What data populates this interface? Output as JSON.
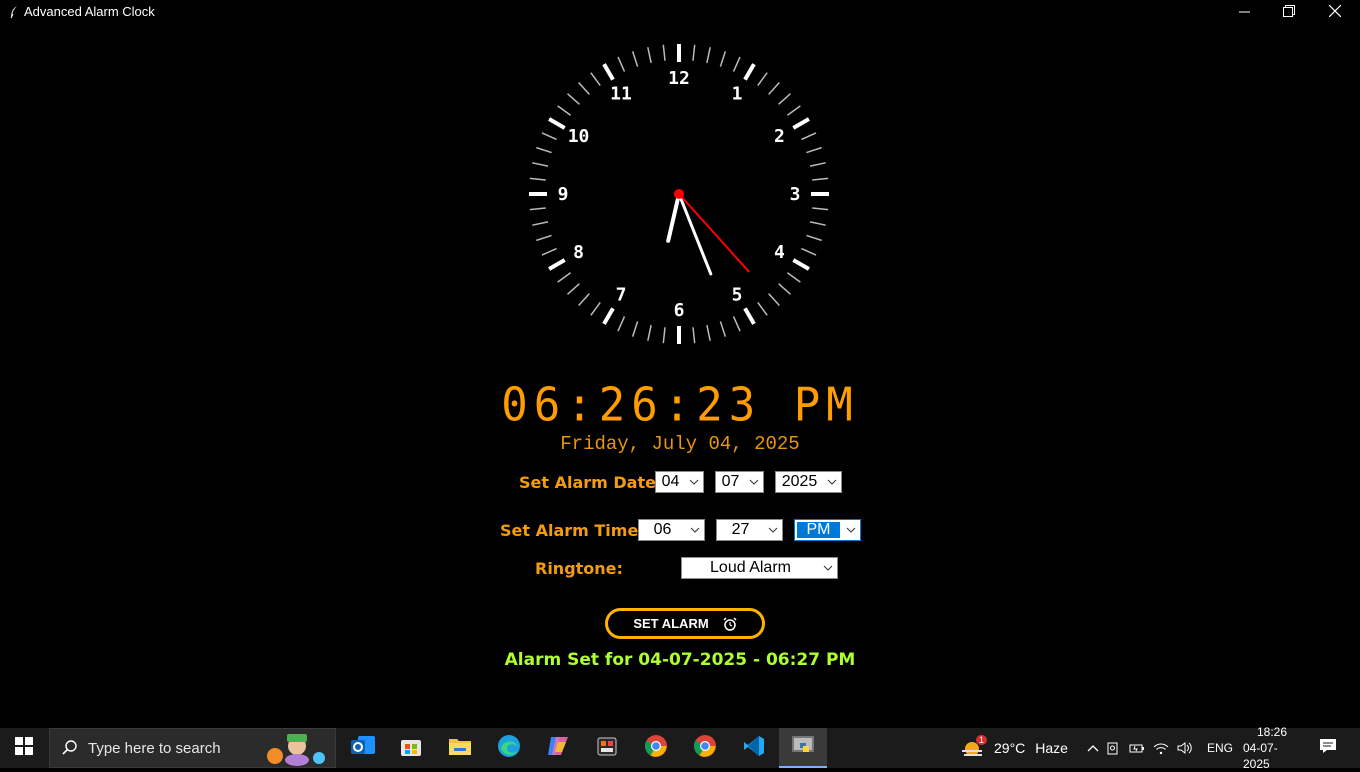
{
  "window": {
    "title": "Advanced Alarm Clock",
    "minimize_icon": "minimize-icon",
    "maximize_icon": "restore-icon",
    "close_icon": "close-icon"
  },
  "analog_clock": {
    "numerals": [
      "12",
      "1",
      "2",
      "3",
      "4",
      "5",
      "6",
      "7",
      "8",
      "9",
      "10",
      "11"
    ],
    "time": {
      "hour": 6,
      "minute": 26,
      "second": 23
    },
    "colors": {
      "face": "#000000",
      "ticks": "#ffffff",
      "second_hand": "#ff0000",
      "center": "#ff0000"
    }
  },
  "digital_time": "06:26:23 PM",
  "date_text": "Friday, July 04, 2025",
  "alarm_form": {
    "date_label": "Set Alarm Date:",
    "date_day": "04",
    "date_month": "07",
    "date_year": "2025",
    "time_label": "Set Alarm Time:",
    "time_hour": "06",
    "time_minute": "27",
    "time_ampm": "PM",
    "ringtone_label": "Ringtone:",
    "ringtone": "Loud Alarm"
  },
  "set_alarm_button": {
    "label": "SET ALARM",
    "icon": "alarm-clock-icon"
  },
  "status_text": "Alarm Set for 04-07-2025 - 06:27 PM",
  "colors": {
    "accent": "#f39c12",
    "digital": "#ff9d00",
    "status": "#adff2f",
    "button_border": "#ffb300"
  },
  "taskbar": {
    "search_placeholder": "Type here to search",
    "apps": [
      "outlook-icon",
      "microsoft-store-icon",
      "file-explorer-icon",
      "edge-icon",
      "copilot-icon",
      "app-icon",
      "chrome-icon",
      "chrome-icon",
      "vscode-icon",
      "python-icon"
    ],
    "weather_badge": "1",
    "weather": "29°C",
    "weather_desc": "Haze",
    "language": "ENG",
    "clock_time": "18:26",
    "clock_date": "04-07-2025"
  }
}
